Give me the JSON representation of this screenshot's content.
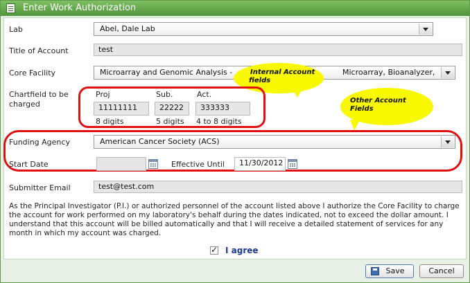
{
  "window": {
    "title": "Enter Work Authorization",
    "icon": "form-icon"
  },
  "form": {
    "lab": {
      "label": "Lab",
      "value": "Abel, Dale Lab"
    },
    "title_of_account": {
      "label": "Title of Account",
      "value": "test"
    },
    "core_facility": {
      "label": "Core Facility",
      "value_left": "Microarray and Genomic Analysis -",
      "value_right": "Microarray, Bioanalyzer,"
    },
    "chartfield": {
      "label_line1": "Chartfield to be",
      "label_line2": "charged",
      "proj": {
        "header": "Proj",
        "value": "11111111",
        "hint": "8 digits"
      },
      "sub": {
        "header": "Sub.",
        "value": "22222",
        "hint": "5 digits"
      },
      "act": {
        "header": "Act.",
        "value": "333333",
        "hint": "4 to 8 digits"
      }
    },
    "funding_agency": {
      "label": "Funding Agency",
      "value": "American Cancer Society (ACS)"
    },
    "start_date": {
      "label": "Start Date",
      "value": ""
    },
    "effective_until": {
      "label": "Effective Until",
      "value": "11/30/2012"
    },
    "submitter_email": {
      "label": "Submitter Email",
      "value": "test@test.com"
    },
    "agreement_text": "As the Principal Investigator (P.I.) or authorized personnel of the account listed above I authorize the Core Facility to charge the account for work performed on my laboratory's behalf during the dates indicated, not to exceed the dollar amount.  I understand that this account will be billed automatically and that I will receive a detailed statement of services for any month in which my account was charged.",
    "agree": {
      "label": "I agree",
      "checked": true
    }
  },
  "annotations": {
    "internal": {
      "line1": "Internal Account",
      "line2": "fields"
    },
    "other": {
      "line1": "Other Account",
      "line2": "Fields"
    },
    "callout_color": "#f8f800",
    "loop_color": "#e01010"
  },
  "buttons": {
    "save": "Save",
    "cancel": "Cancel"
  }
}
